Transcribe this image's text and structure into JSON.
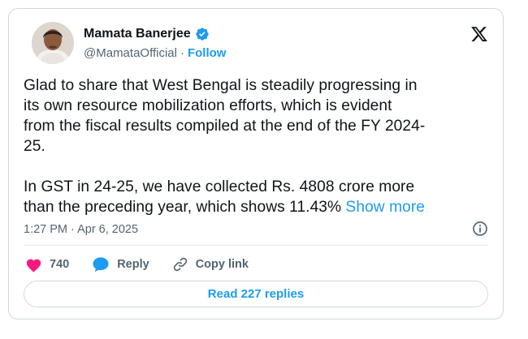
{
  "author": {
    "display_name": "Mamata Banerjee",
    "handle": "@MamataOfficial",
    "separator": "·",
    "follow_label": "Follow"
  },
  "tweet": {
    "text": "Glad to share that West Bengal is steadily progressing in\nits own resource mobilization efforts, which is evident\nfrom the fiscal results compiled at the end of the FY 2024-\n25.\n\nIn GST in 24-25, we have collected Rs. 4808 crore more\nthan the preceding year, which shows 11.43% ",
    "show_more_label": "Show more",
    "timestamp": "1:27 PM · Apr 6, 2025"
  },
  "actions": {
    "like_count": "740",
    "reply_label": "Reply",
    "copy_link_label": "Copy link"
  },
  "read_replies_label": "Read 227 replies",
  "colors": {
    "accent": "#1d9bf0",
    "like": "#f91880",
    "text": "#0f1419",
    "muted": "#536471"
  },
  "icons": [
    "verified-badge-icon",
    "x-logo-icon",
    "info-icon",
    "heart-icon",
    "reply-bubble-icon",
    "link-icon"
  ]
}
